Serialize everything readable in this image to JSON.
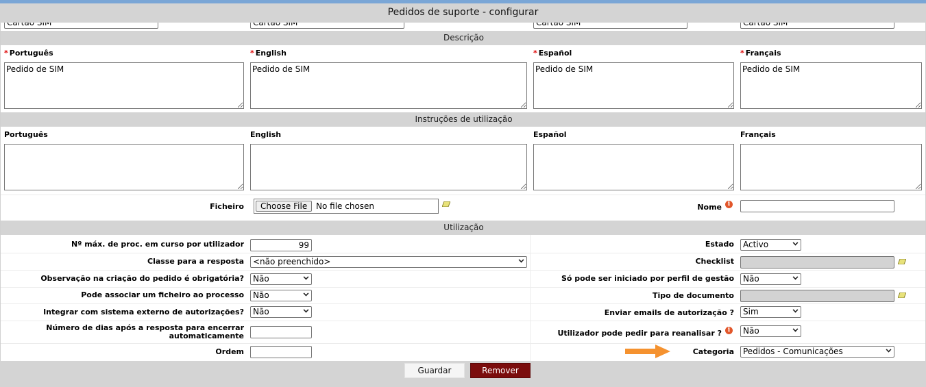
{
  "title": "Pedidos de suporte - configurar",
  "top_fields": {
    "pt": "Cartão SIM",
    "en": "Cartão SIM",
    "es": "Cartão SIM",
    "fr": "Cartão SIM"
  },
  "descricao": {
    "header": "Descrição",
    "labels": {
      "pt": "Português",
      "en": "English",
      "es": "Español",
      "fr": "Français"
    },
    "values": {
      "pt": "Pedido de SIM",
      "en": "Pedido de SIM",
      "es": "Pedido de SIM",
      "fr": "Pedido de SIM"
    }
  },
  "instrucoes": {
    "header": "Instruções de utilização",
    "labels": {
      "pt": "Português",
      "en": "English",
      "es": "Español",
      "fr": "Français"
    },
    "values": {
      "pt": "",
      "en": "",
      "es": "",
      "fr": ""
    }
  },
  "ficheiro": {
    "label": "Ficheiro",
    "button": "Choose File",
    "status": "No file chosen",
    "nome_label": "Nome",
    "nome_value": ""
  },
  "utilizacao": {
    "header": "Utilização",
    "left": {
      "max_proc_label": "Nº máx. de proc. em curso por utilizador",
      "max_proc_value": "99",
      "classe_label": "Classe para a resposta",
      "classe_value": "<não preenchido>",
      "observacao_label": "Observação na criação do pedido é obrigatória?",
      "observacao_value": "Não",
      "associar_label": "Pode associar um ficheiro ao processo",
      "associar_value": "Não",
      "integrar_label": "Integrar com sistema externo de autorizações?",
      "integrar_value": "Não",
      "dias_label": "Número de dias após a resposta para encerrar automaticamente",
      "dias_value": "",
      "ordem_label": "Ordem",
      "ordem_value": ""
    },
    "right": {
      "estado_label": "Estado",
      "estado_value": "Activo",
      "checklist_label": "Checklist",
      "checklist_value": "",
      "perfil_label": "Só pode ser iniciado por perfil de gestão",
      "perfil_value": "Não",
      "tipo_doc_label": "Tipo de documento",
      "tipo_doc_value": "",
      "emails_label": "Enviar emails de autorização ?",
      "emails_value": "Sim",
      "reanalisar_label": "Utilizador pode pedir para reanalisar ?",
      "reanalisar_value": "Não",
      "categoria_label": "Categoria",
      "categoria_value": "Pedidos - Comunicações"
    }
  },
  "buttons": {
    "save": "Guardar",
    "remove": "Remover"
  },
  "icons": {
    "info": "i"
  },
  "colors": {
    "accent_bar": "#7aa6d6",
    "remove_button": "#7b0d0d",
    "arrow": "#f5922f",
    "required": "#dd0000",
    "info": "#e2572b"
  }
}
